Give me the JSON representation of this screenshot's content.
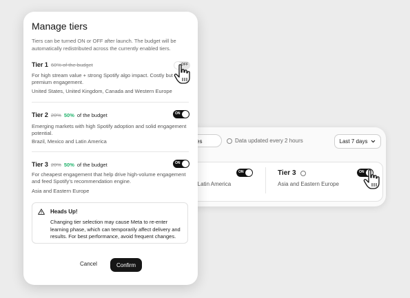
{
  "modal": {
    "title": "Manage tiers",
    "subtitle": "Tiers can be turned ON or OFF after launch. The budget will be automatically redistributed across the currently enabled tiers.",
    "tiers": [
      {
        "name": "Tier 1",
        "old_pct": "60% of the budget",
        "new_pct": "",
        "suffix": "",
        "description": "For high stream value + strong Spotify algo impact. Costly but premium engagement.",
        "regions": "United States, United Kingdom, Canada and Western Europe",
        "toggle_label": "OFF",
        "enabled": false
      },
      {
        "name": "Tier 2",
        "old_pct": "20%",
        "new_pct": "50%",
        "suffix": "of the budget",
        "description": "Emerging markets with high Spotify adoption and solid engagement potential.",
        "regions": "Brazil, Mexico and Latin America",
        "toggle_label": "ON",
        "enabled": true
      },
      {
        "name": "Tier 3",
        "old_pct": "20%",
        "new_pct": "50%",
        "suffix": "of the budget",
        "description": "For cheapest engagement that help drive high-volume engagement and feed Spotify’s recommendation engine.",
        "regions": "Asia and Eastern Europe",
        "toggle_label": "ON",
        "enabled": true
      }
    ],
    "alert": {
      "title": "Heads Up!",
      "body": "Changing tier selection may cause Meta to re-enter learning phase, which can temporarily affect delivery and results. For best performance, avoid frequent changes."
    },
    "cancel_label": "Cancel",
    "confirm_label": "Confirm"
  },
  "background": {
    "pill_label": "es",
    "updated_text": "Data updated every 2 hours",
    "range_select": "Last 7 days",
    "left_tier_desc": "d Latin America",
    "left_toggle_label": "ON",
    "tier3_title": "Tier 3",
    "tier3_desc": "Asia and Eastern Europe",
    "tier3_toggle_label": "ON"
  },
  "colors": {
    "accent_green": "#22b46c",
    "dark": "#161616"
  }
}
